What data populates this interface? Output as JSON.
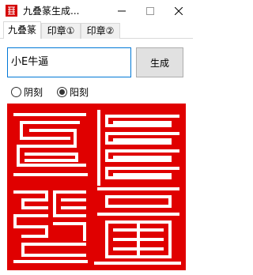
{
  "window": {
    "title": "九叠篆生成...",
    "icon": "seal-app-icon",
    "controls": [
      "minimize-icon",
      "maximize-icon",
      "close-icon"
    ]
  },
  "tabs": [
    {
      "label": "九叠篆",
      "active": true
    },
    {
      "label": "印章①",
      "active": false
    },
    {
      "label": "印章②",
      "active": false
    }
  ],
  "form": {
    "name_value": "小E牛逼",
    "generate_label": "生成",
    "options": [
      {
        "label": "阴刻",
        "checked": false
      },
      {
        "label": "阳刻",
        "checked": true
      }
    ]
  },
  "seal": {
    "color": "#e00000",
    "background": "#ffffff"
  }
}
